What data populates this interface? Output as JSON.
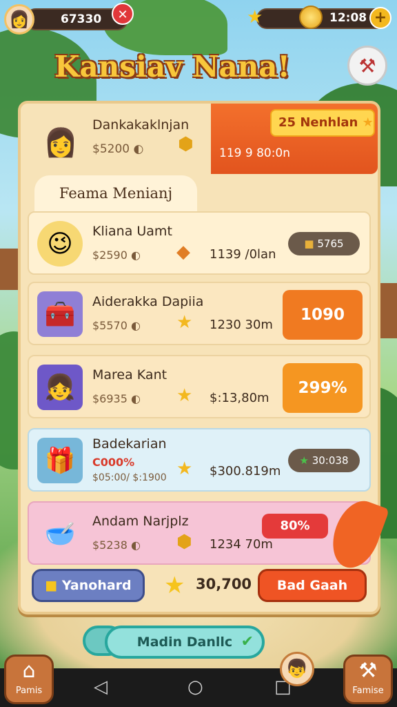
{
  "hud": {
    "player_value": "67330",
    "currency_value": "12:08"
  },
  "title": "Kansiav Nana!",
  "featured": {
    "name": "Dankakaklnjan",
    "price": "$5200",
    "price_icon": "◐",
    "badge": "25 Nenhlan",
    "time": "119 9 80:0n"
  },
  "section_tab": "Feama Menianj",
  "rows": [
    {
      "name": "Kliana Uamt",
      "price": "$2590",
      "price_icon": "◐",
      "time": "1139 /0lan",
      "pill": "5765",
      "bg": "#fff1d2"
    },
    {
      "name": "Aiderakka Dapiia",
      "price": "$5570",
      "price_icon": "◐",
      "time": "1230 30m",
      "button": "1090",
      "bg": "#fbe7c0",
      "button_color": "#f07a21"
    },
    {
      "name": "Marea Kant",
      "price": "$6935",
      "price_icon": "◐",
      "time": "$:13,80m",
      "button": "299%",
      "bg": "#fbe7c0",
      "button_color": "#f59621"
    },
    {
      "name": "Badekarian",
      "price_sale": "C000%",
      "price": "$05:00/ $:1900",
      "time": "$300.819m",
      "pill": "30:038",
      "bg": "#dff1f8"
    },
    {
      "name": "Andam Narjplz",
      "price": "$5238",
      "price_icon": "◐",
      "time": "1234 70m",
      "button": "80%",
      "bg": "#f6c4d6",
      "button_color": "#e43a3a"
    }
  ],
  "bottom_bar": {
    "left_button": "Yanohard",
    "score": "30,700",
    "right_button": "Bad Gaah"
  },
  "teal_button": "Madin Danllc",
  "corner_left": "Pamis",
  "corner_right": "Famise"
}
